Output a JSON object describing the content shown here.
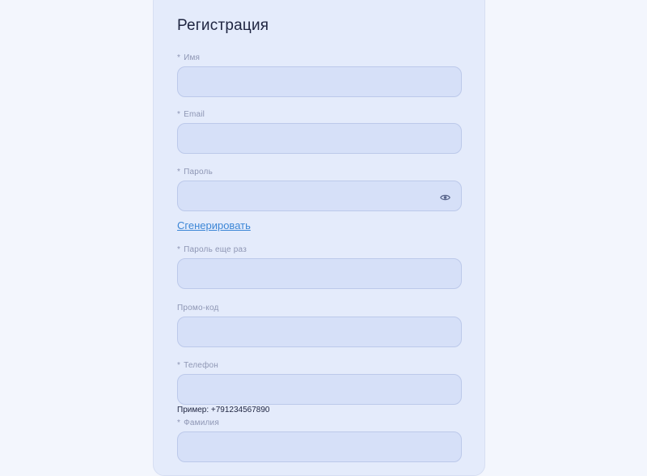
{
  "form": {
    "title": "Регистрация",
    "required_mark": "*",
    "fields": [
      {
        "label": "Имя",
        "required": true,
        "value": ""
      },
      {
        "label": "Email",
        "required": true,
        "value": ""
      },
      {
        "label": "Пароль",
        "required": true,
        "value": ""
      },
      {
        "label": "Пароль еще раз",
        "required": true,
        "value": ""
      },
      {
        "label": "Промо-код",
        "required": false,
        "value": ""
      },
      {
        "label": "Телефон",
        "required": true,
        "value": ""
      },
      {
        "label": "Фамилия",
        "required": true,
        "value": ""
      }
    ],
    "generate_link": "Сгенерировать",
    "phone_hint": "Пример: +791234567890"
  },
  "icons": {
    "password_toggle": "eye-icon"
  },
  "colors": {
    "page_bg": "#f3f6fd",
    "card_bg": "#e4ebfb",
    "input_bg": "#d6e0f8",
    "link": "#3c86d6",
    "text": "#1e2440",
    "label": "#8e96b4"
  }
}
